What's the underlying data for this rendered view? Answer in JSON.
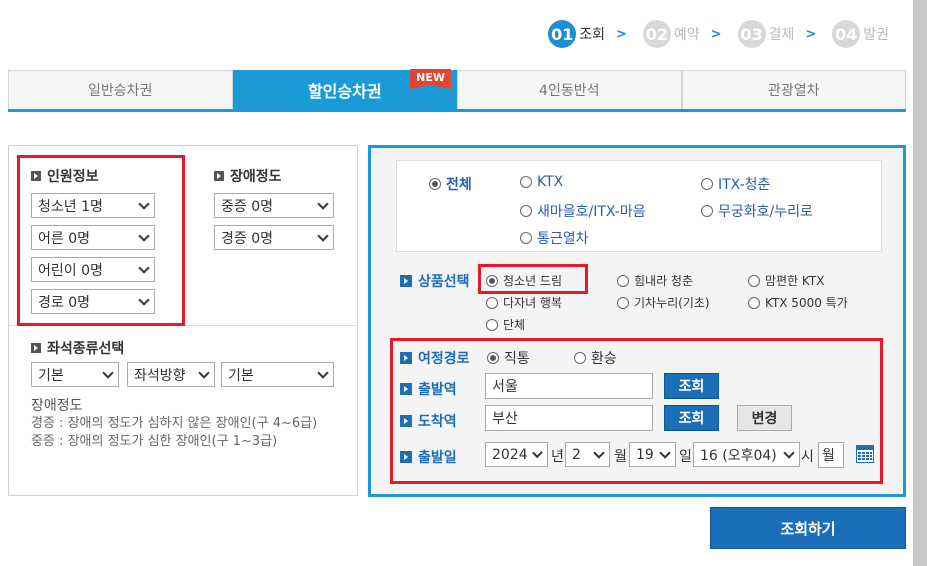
{
  "steps": [
    {
      "num": "01",
      "label": "조회"
    },
    {
      "num": "02",
      "label": "예약"
    },
    {
      "num": "03",
      "label": "결제"
    },
    {
      "num": "04",
      "label": "발권"
    }
  ],
  "tabs": [
    "일반승차권",
    "할인승차권",
    "4인동반석",
    "관광열차"
  ],
  "tab_badge": "NEW",
  "passenger": {
    "title": "인원정보",
    "selects": [
      "청소년 1명",
      "어른 0명",
      "어린이 0명",
      "경로 0명"
    ]
  },
  "disability": {
    "title": "장애정도",
    "selects": [
      "중증 0명",
      "경증 0명"
    ]
  },
  "seat": {
    "title": "좌석종류선택",
    "selects": [
      "기본",
      "좌석방향",
      "기본"
    ]
  },
  "notes": {
    "title": "장애정도",
    "line1": "경증 : 장애의 정도가 심하지 않은 장애인(구 4~6급)",
    "line2": "중증 : 장애의 정도가 심한 장애인(구 1~3급)"
  },
  "train_types": [
    "전체",
    "KTX",
    "ITX-청춘",
    "새마을호/ITX-마음",
    "무궁화호/누리로",
    "통근열차"
  ],
  "product": {
    "label": "상품선택",
    "options": [
      "청소년 드림",
      "힘내라 청춘",
      "맘편한 KTX",
      "다자녀 행복",
      "기차누리(기초)",
      "KTX 5000 특가",
      "단체"
    ]
  },
  "route": {
    "label": "여정경로",
    "options": [
      "직통",
      "환승"
    ]
  },
  "departure": {
    "label": "출발역",
    "value": "서울",
    "button": "조회"
  },
  "arrival": {
    "label": "도착역",
    "value": "부산",
    "button": "조회",
    "swap": "변경"
  },
  "date": {
    "label": "출발일",
    "year": "2024",
    "year_unit": "년",
    "month": "2",
    "month_unit": "월",
    "day": "19",
    "day_unit": "일",
    "hour": "16 (오후04)",
    "hour_unit": "시",
    "weekday": "월"
  },
  "search_button": "조회하기",
  "colors": {
    "accent": "#1a9ad6",
    "highlight": "#e8192c",
    "button": "#1a6fb8"
  }
}
